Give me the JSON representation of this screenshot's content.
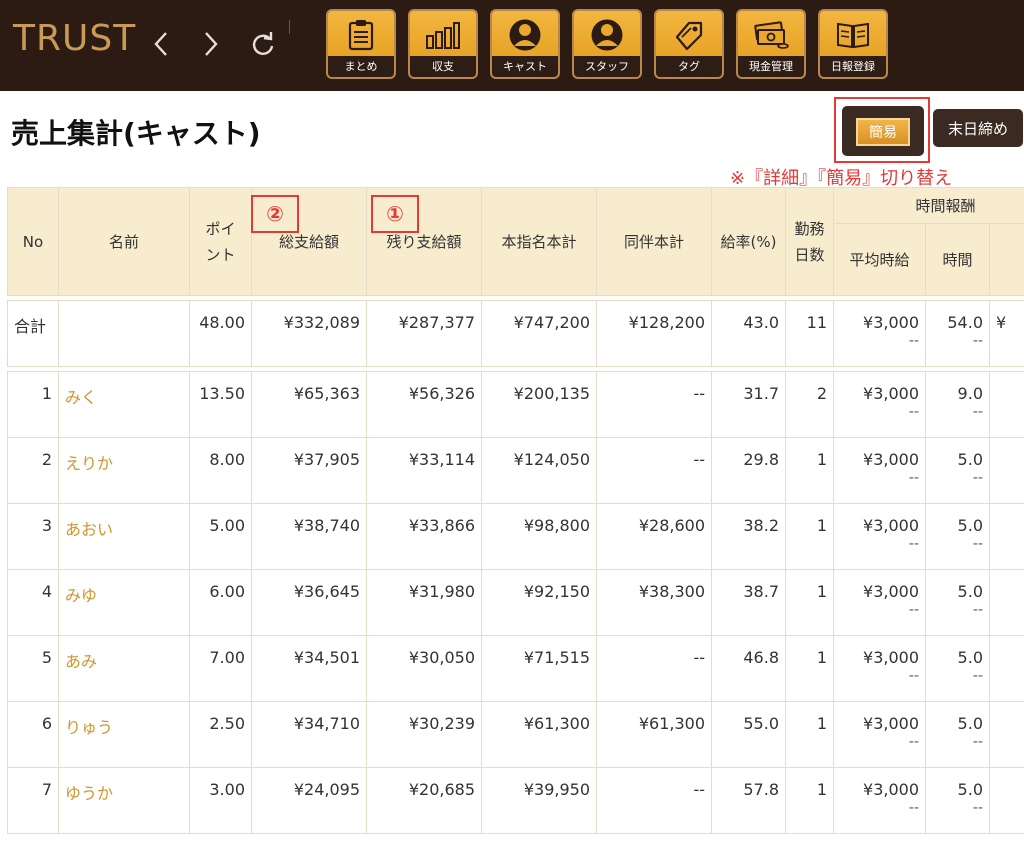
{
  "app": {
    "logo": "TRUST"
  },
  "toolbar": {
    "items": [
      {
        "label": "まとめ",
        "icon": "clipboard-icon"
      },
      {
        "label": "収支",
        "icon": "bar-chart-icon"
      },
      {
        "label": "キャスト",
        "icon": "cast-person-icon"
      },
      {
        "label": "スタッフ",
        "icon": "staff-person-icon"
      },
      {
        "label": "タグ",
        "icon": "tag-icon"
      },
      {
        "label": "現金管理",
        "icon": "cash-icon"
      },
      {
        "label": "日報登録",
        "icon": "book-icon"
      }
    ]
  },
  "page": {
    "title": "売上集計(キャスト)",
    "mode_button": "簡易",
    "close_button": "末日締め",
    "note": "※『詳細』『簡易』切り替え"
  },
  "annotations": {
    "badge1": "①",
    "badge2": "②"
  },
  "table": {
    "headers": {
      "no": "No",
      "name": "名前",
      "point": "ポイント",
      "total_pay": "総支給額",
      "remaining_pay": "残り支給額",
      "designation_total": "本指名本計",
      "accompany_total": "同伴本計",
      "pay_rate": "給率(%)",
      "work_days": "勤務日数",
      "hourly_group": "時間報酬",
      "avg_hourly": "平均時給",
      "hours": "時間"
    },
    "total": {
      "label": "合計",
      "point": "48.00",
      "total_pay": "¥332,089",
      "remaining_pay": "¥287,377",
      "designation_total": "¥747,200",
      "accompany_total": "¥128,200",
      "pay_rate": "43.0",
      "work_days": "11",
      "avg_hourly": "¥3,000",
      "avg_hourly_sub": "--",
      "hours": "54.0",
      "hours_sub": "--"
    },
    "rows": [
      {
        "no": "1",
        "name": "みく",
        "point": "13.50",
        "total_pay": "¥65,363",
        "remaining_pay": "¥56,326",
        "designation_total": "¥200,135",
        "accompany_total": "--",
        "pay_rate": "31.7",
        "work_days": "2",
        "avg_hourly": "¥3,000",
        "avg_hourly_sub": "--",
        "hours": "9.0",
        "hours_sub": "--"
      },
      {
        "no": "2",
        "name": "えりか",
        "point": "8.00",
        "total_pay": "¥37,905",
        "remaining_pay": "¥33,114",
        "designation_total": "¥124,050",
        "accompany_total": "--",
        "pay_rate": "29.8",
        "work_days": "1",
        "avg_hourly": "¥3,000",
        "avg_hourly_sub": "--",
        "hours": "5.0",
        "hours_sub": "--"
      },
      {
        "no": "3",
        "name": "あおい",
        "point": "5.00",
        "total_pay": "¥38,740",
        "remaining_pay": "¥33,866",
        "designation_total": "¥98,800",
        "accompany_total": "¥28,600",
        "pay_rate": "38.2",
        "work_days": "1",
        "avg_hourly": "¥3,000",
        "avg_hourly_sub": "--",
        "hours": "5.0",
        "hours_sub": "--"
      },
      {
        "no": "4",
        "name": "みゆ",
        "point": "6.00",
        "total_pay": "¥36,645",
        "remaining_pay": "¥31,980",
        "designation_total": "¥92,150",
        "accompany_total": "¥38,300",
        "pay_rate": "38.7",
        "work_days": "1",
        "avg_hourly": "¥3,000",
        "avg_hourly_sub": "--",
        "hours": "5.0",
        "hours_sub": "--"
      },
      {
        "no": "5",
        "name": "あみ",
        "point": "7.00",
        "total_pay": "¥34,501",
        "remaining_pay": "¥30,050",
        "designation_total": "¥71,515",
        "accompany_total": "--",
        "pay_rate": "46.8",
        "work_days": "1",
        "avg_hourly": "¥3,000",
        "avg_hourly_sub": "--",
        "hours": "5.0",
        "hours_sub": "--"
      },
      {
        "no": "6",
        "name": "りゅう",
        "point": "2.50",
        "total_pay": "¥34,710",
        "remaining_pay": "¥30,239",
        "designation_total": "¥61,300",
        "accompany_total": "¥61,300",
        "pay_rate": "55.0",
        "work_days": "1",
        "avg_hourly": "¥3,000",
        "avg_hourly_sub": "--",
        "hours": "5.0",
        "hours_sub": "--"
      },
      {
        "no": "7",
        "name": "ゆうか",
        "point": "3.00",
        "total_pay": "¥24,095",
        "remaining_pay": "¥20,685",
        "designation_total": "¥39,950",
        "accompany_total": "--",
        "pay_rate": "57.8",
        "work_days": "1",
        "avg_hourly": "¥3,000",
        "avg_hourly_sub": "--",
        "hours": "5.0",
        "hours_sub": "--"
      }
    ]
  },
  "colors": {
    "header_bg": "#2b1b13",
    "accent_gold": "#e39a1a",
    "name_link": "#d1952f",
    "table_header_bg": "#f7ecce",
    "annotation_red": "#e53935"
  }
}
